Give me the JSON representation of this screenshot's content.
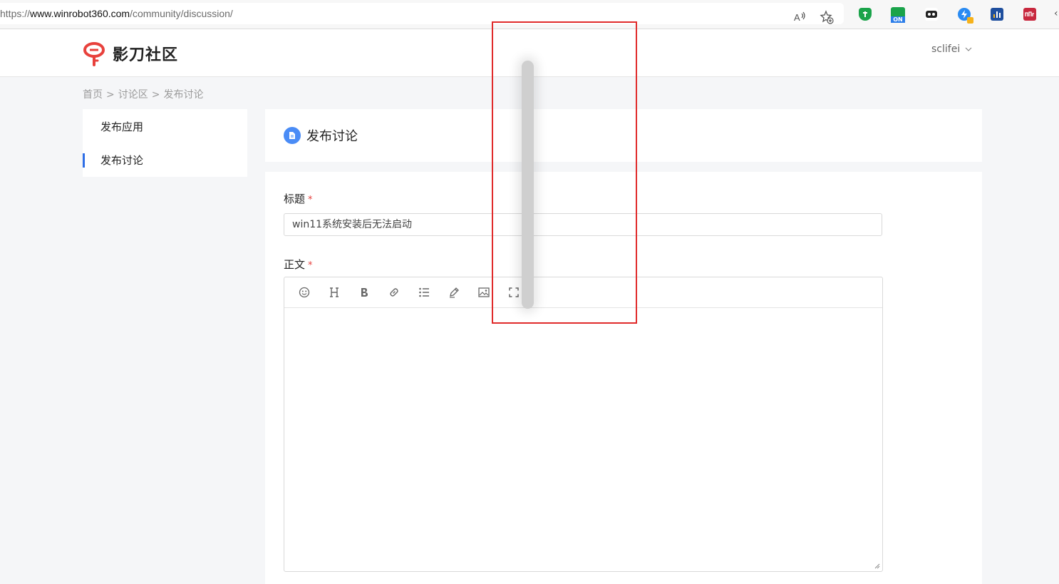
{
  "browser": {
    "url_prefix": "https://",
    "url_host": "www.winrobot360.com",
    "url_path": "/community/discussion/",
    "read_aloud_icon": "read-aloud-icon",
    "favorite_icon": "add-favorite-icon",
    "extensions": [
      {
        "name": "shield-extension-icon",
        "color": "#1aa34a"
      },
      {
        "name": "on-extension-icon",
        "color": "#2b7de9",
        "text": "ON"
      },
      {
        "name": "mask-extension-icon",
        "color": "#222222"
      },
      {
        "name": "lightning-extension-icon",
        "color": "#2a8bf2"
      },
      {
        "name": "chart-extension-icon",
        "color": "#1f4f9e"
      },
      {
        "name": "red-extension-icon",
        "color": "#c8283e"
      }
    ]
  },
  "header": {
    "logo_text": "影刀社区",
    "brand_color": "#e8413c",
    "username": "sclifei"
  },
  "breadcrumb": {
    "items": [
      "首页",
      "讨论区",
      "发布讨论"
    ],
    "separator": ">"
  },
  "sidebar": {
    "items": [
      {
        "label": "发布应用",
        "active": false
      },
      {
        "label": "发布讨论",
        "active": true
      }
    ],
    "accent": "#2e6ee6"
  },
  "page": {
    "title": "发布讨论",
    "title_icon_color": "#4a8cf6"
  },
  "form": {
    "title_label": "标题",
    "title_value": "win11系统安装后无法启动",
    "body_label": "正文",
    "required_mark": "*",
    "toolbar": [
      "emoji-icon",
      "heading-icon",
      "bold-icon",
      "link-icon",
      "list-icon",
      "pen-icon",
      "image-icon",
      "fullscreen-icon"
    ],
    "body_value": ""
  },
  "overlay": {
    "highlight_color": "#e02b2b"
  }
}
